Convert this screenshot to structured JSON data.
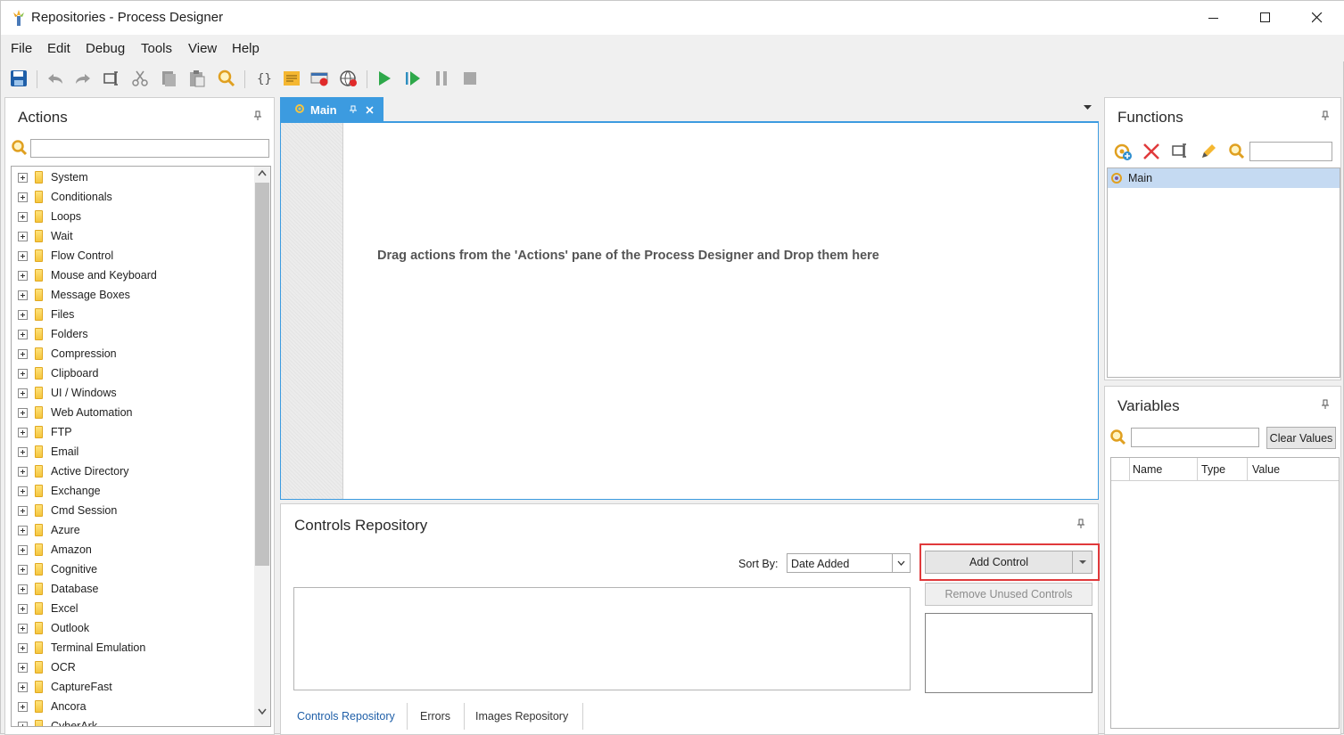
{
  "window": {
    "title": "Repositories - Process Designer",
    "controls": {
      "minimize": "—",
      "maximize": "☐",
      "close": "✕"
    }
  },
  "menu": [
    "File",
    "Edit",
    "Debug",
    "Tools",
    "View",
    "Help"
  ],
  "toolbar_icons": [
    "save-icon",
    "undo-icon",
    "redo-icon",
    "rename-icon",
    "cut-icon",
    "copy-icon",
    "paste-icon",
    "find-icon",
    "braces-icon",
    "notes-icon",
    "record-icon",
    "web-recorder-icon",
    "run-icon",
    "step-run-icon",
    "pause-icon",
    "stop-icon"
  ],
  "actions_panel": {
    "title": "Actions",
    "search_value": "",
    "items": [
      "System",
      "Conditionals",
      "Loops",
      "Wait",
      "Flow Control",
      "Mouse and Keyboard",
      "Message Boxes",
      "Files",
      "Folders",
      "Compression",
      "Clipboard",
      "UI / Windows",
      "Web Automation",
      "FTP",
      "Email",
      "Active Directory",
      "Exchange",
      "Cmd Session",
      "Azure",
      "Amazon",
      "Cognitive",
      "Database",
      "Excel",
      "Outlook",
      "Terminal Emulation",
      "OCR",
      "CaptureFast",
      "Ancora",
      "CyberArk"
    ]
  },
  "designer": {
    "tab_label": "Main",
    "drop_hint": "Drag actions from the 'Actions' pane of the Process Designer and Drop them here"
  },
  "controls_repository": {
    "title": "Controls Repository",
    "sort_by_label": "Sort By:",
    "sort_by_value": "Date Added",
    "add_control": "Add Control",
    "remove_unused": "Remove Unused Controls",
    "tabs": [
      "Controls Repository",
      "Errors",
      "Images Repository"
    ],
    "active_tab": "Controls Repository"
  },
  "functions_panel": {
    "title": "Functions",
    "search_value": "",
    "items": [
      "Main"
    ],
    "selected": "Main"
  },
  "variables_panel": {
    "title": "Variables",
    "search_value": "",
    "clear_values": "Clear Values",
    "columns": [
      "Name",
      "Type",
      "Value"
    ]
  },
  "colors": {
    "accent": "#3c9be0",
    "highlight_border": "#e0393b",
    "selection": "#c5daf2"
  }
}
